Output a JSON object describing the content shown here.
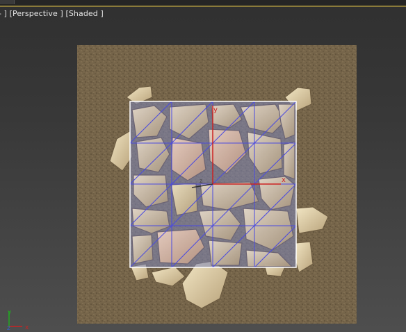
{
  "viewport": {
    "label_parts": [
      "- ]",
      " [Perspective ]",
      " [Shaded ]"
    ],
    "view_name": "Perspective",
    "shading_mode": "Shaded"
  },
  "gizmo": {
    "axis_x": "x",
    "axis_y": "y",
    "axis_z": "z"
  },
  "world_axes": {
    "x": "x",
    "y": "y",
    "z": "z"
  },
  "colors": {
    "ground": "#7a6848",
    "grid_line": "#4a4ae0",
    "selection_box": "#ffffff",
    "axis_x": "#cc2222",
    "axis_y": "#22aa22",
    "axis_z": "#3366cc"
  }
}
